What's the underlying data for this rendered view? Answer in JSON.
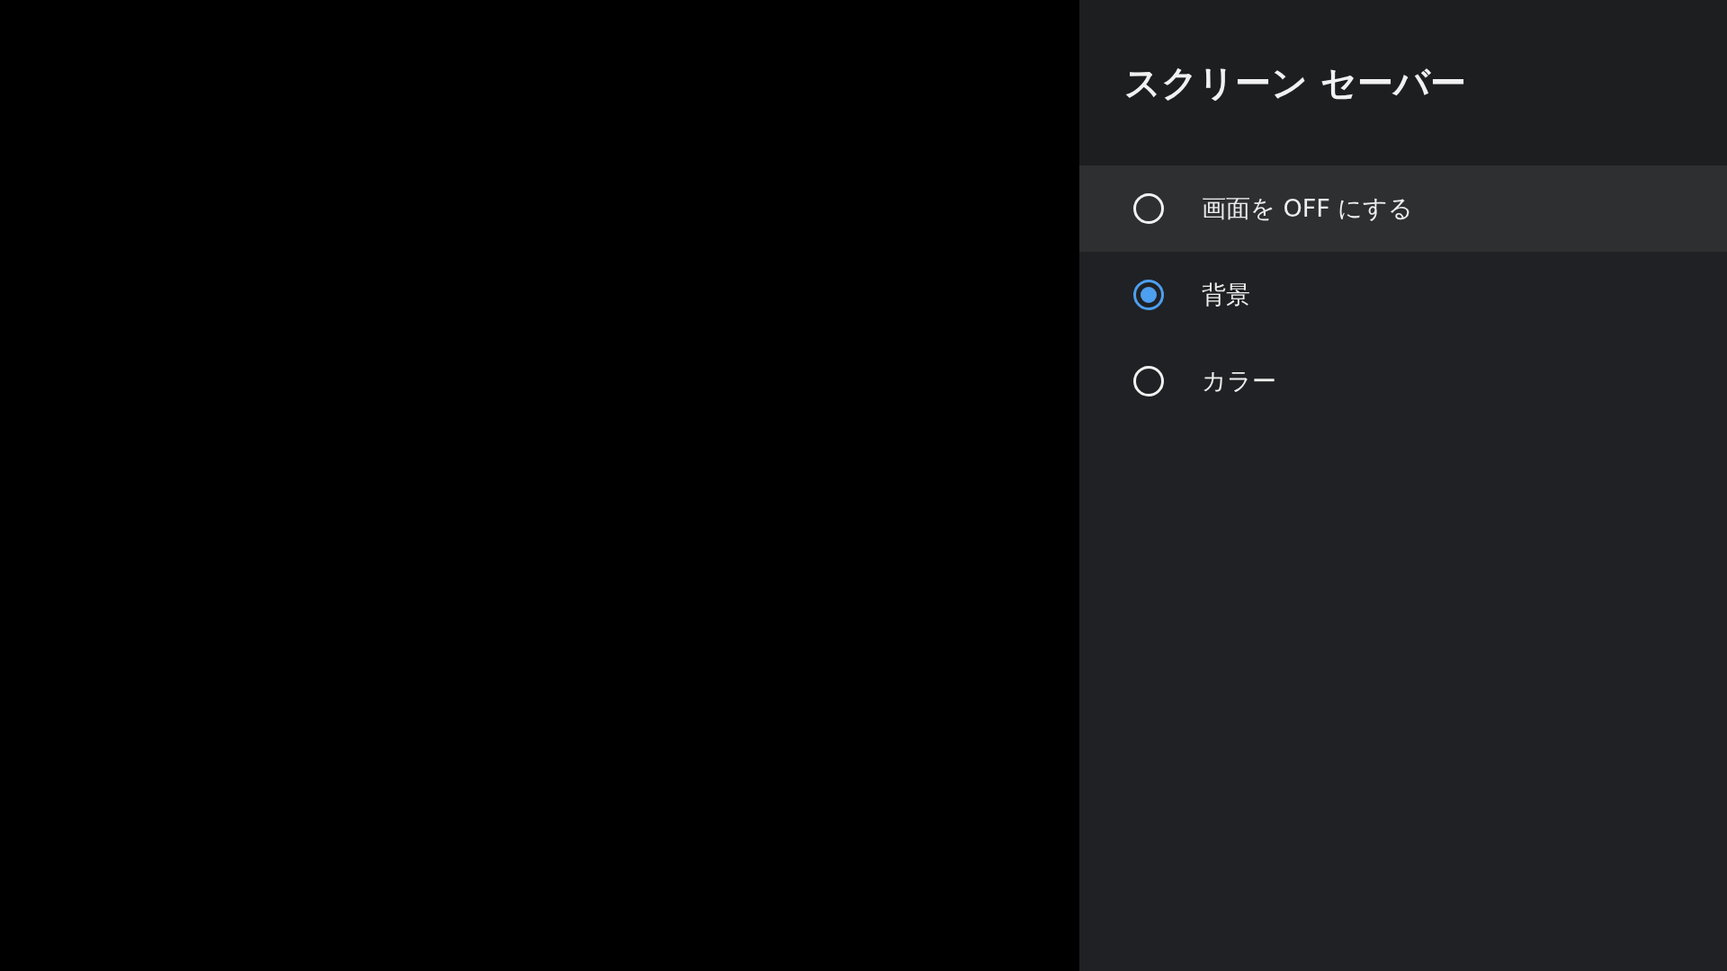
{
  "panel": {
    "title": "スクリーン セーバー"
  },
  "options": [
    {
      "label": "画面を OFF にする",
      "selected": false,
      "focused": true
    },
    {
      "label": "背景",
      "selected": true,
      "focused": false
    },
    {
      "label": "カラー",
      "selected": false,
      "focused": false
    }
  ]
}
